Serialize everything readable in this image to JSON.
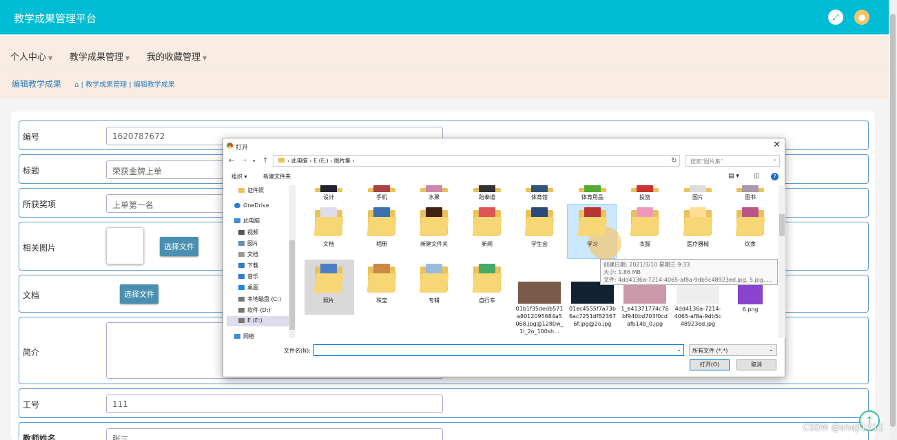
{
  "app": {
    "title": "教学成果管理平台"
  },
  "menu": [
    {
      "label": "个人中心"
    },
    {
      "label": "教学成果管理"
    },
    {
      "label": "我的收藏管理"
    }
  ],
  "breadcrumb": {
    "title": "编辑教学成果",
    "path": "| 教学成果管理 | 编辑教学成果"
  },
  "form": {
    "number": {
      "label": "编号",
      "value": "1620787672"
    },
    "title": {
      "label": "标题",
      "value": "荣获金牌上单"
    },
    "award": {
      "label": "所获奖项",
      "value": "上单第一名"
    },
    "image": {
      "label": "相关图片",
      "button": "选择文件"
    },
    "doc": {
      "label": "文档",
      "button": "选择文件"
    },
    "intro": {
      "label": "简介"
    },
    "worker_id": {
      "label": "工号",
      "value": "111"
    },
    "teacher": {
      "label": "教师姓名",
      "value": "张三"
    }
  },
  "watermark": "CSDN @shejl1011",
  "dialog": {
    "title": "打开",
    "address": "› 此电脑 › E (E:) › 图片集 ›",
    "search_placeholder": "搜索\"图片集\"",
    "toolbar": {
      "organize": "组织 ▾",
      "new_folder": "新建文件夹"
    },
    "sidebar": [
      {
        "label": "证件照",
        "icon": "folder-icon"
      },
      {
        "label": "OneDrive",
        "icon": "cloud-icon"
      },
      {
        "label": "此电脑",
        "icon": "computer-icon"
      },
      {
        "label": "视频",
        "icon": "video-icon"
      },
      {
        "label": "图片",
        "icon": "picture-icon"
      },
      {
        "label": "文档",
        "icon": "document-icon"
      },
      {
        "label": "下载",
        "icon": "download-icon"
      },
      {
        "label": "音乐",
        "icon": "music-icon"
      },
      {
        "label": "桌面",
        "icon": "desktop-icon"
      },
      {
        "label": "本地磁盘 (C:)",
        "icon": "drive-icon"
      },
      {
        "label": "软件 (D:)",
        "icon": "drive-icon"
      },
      {
        "label": "E (E:)",
        "icon": "drive-icon"
      },
      {
        "label": "网络",
        "icon": "network-icon"
      }
    ],
    "row1": [
      "设计",
      "手机",
      "水果",
      "跆拳道",
      "体育馆",
      "体育用品",
      "投篮",
      "图片",
      "图书"
    ],
    "row2": [
      "文档",
      "相册",
      "新建文件夹",
      "新闻",
      "学生会",
      "学习",
      "衣服",
      "医疗器械",
      "饮食"
    ],
    "row3_folders": [
      "照片",
      "珠宝",
      "专辑",
      "自行车"
    ],
    "row3_files": [
      "01b1f35dedb571a8012095684a5068.jpg@1280w_1l_2o_100sh...",
      "01ec4555f7a73b6ac7251df823676f.jpg@2o.jpg",
      "1_e41371774c76bf940bd703f0cdafb14b_0.jpg",
      "4dd4136a-7214-4065-af8a-9db5c48923ed.jpg",
      "6.png"
    ],
    "tooltip": {
      "date": "创建日期: 2021/3/10 星期三 9:33",
      "size": "大小: 1.86 MB",
      "files": "文件: 4dd4136a-7214-4065-af8a-9db5c48923ed.jpg, 5.jpg, ..."
    },
    "filename_label": "文件名(N):",
    "filetype": "所有文件 (*.*)",
    "open_button": "打开(O)",
    "cancel_button": "取消"
  }
}
